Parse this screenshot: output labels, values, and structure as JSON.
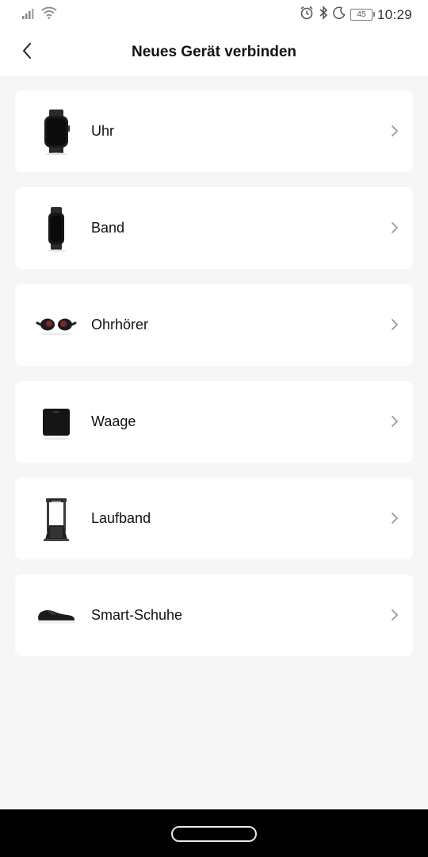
{
  "status_bar": {
    "time": "10:29",
    "battery": "45",
    "icons": [
      "signal-icon",
      "wifi-icon",
      "alarm-icon",
      "bluetooth-icon",
      "moon-icon",
      "battery-icon"
    ]
  },
  "header": {
    "title": "Neues Gerät verbinden",
    "back_icon": "chevron-left-icon"
  },
  "devices": [
    {
      "label": "Uhr",
      "icon": "watch-icon"
    },
    {
      "label": "Band",
      "icon": "fitness-band-icon"
    },
    {
      "label": "Ohrhörer",
      "icon": "earbuds-icon"
    },
    {
      "label": "Waage",
      "icon": "scale-icon"
    },
    {
      "label": "Laufband",
      "icon": "treadmill-icon"
    },
    {
      "label": "Smart-Schuhe",
      "icon": "shoe-icon"
    }
  ],
  "colors": {
    "background": "#f6f6f6",
    "card": "#ffffff",
    "text": "#111111",
    "chevron": "#9a9a9a",
    "nav_bar": "#000000"
  }
}
